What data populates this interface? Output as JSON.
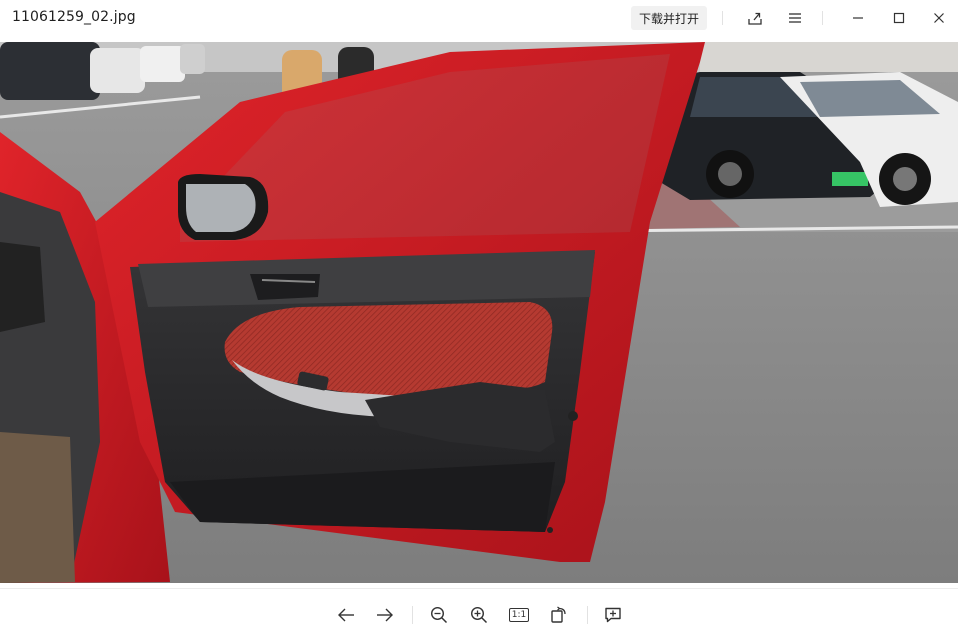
{
  "window": {
    "title": "11061259_02.jpg",
    "open_button_label": "下载并打开"
  },
  "titlebar_icons": [
    {
      "name": "share-icon"
    },
    {
      "name": "menu-icon"
    },
    {
      "name": "minimize-icon"
    },
    {
      "name": "maximize-icon"
    },
    {
      "name": "close-icon"
    }
  ],
  "image": {
    "subject": "open red car door, parking lot",
    "colors": {
      "car_red": "#d3191d",
      "door_panel_dark": "#2a2a2c",
      "door_insert_red": "#b0332c",
      "asphalt": "#858585",
      "sky_building": "#c9c9c9"
    }
  },
  "toolbar": {
    "one_to_one_label": "1:1",
    "icons": [
      {
        "name": "previous-arrow-icon"
      },
      {
        "name": "next-arrow-icon"
      },
      {
        "name": "zoom-out-icon"
      },
      {
        "name": "zoom-in-icon"
      },
      {
        "name": "actual-size-icon"
      },
      {
        "name": "rotate-icon"
      },
      {
        "name": "comment-add-icon"
      }
    ]
  }
}
